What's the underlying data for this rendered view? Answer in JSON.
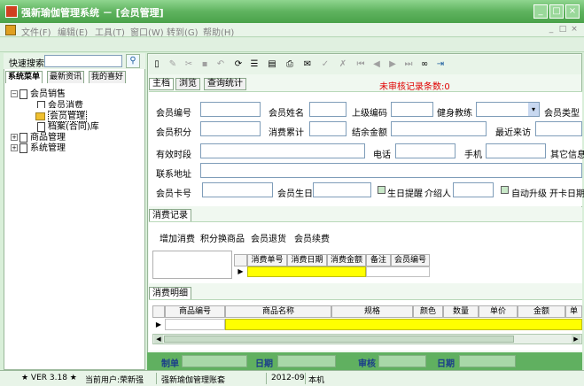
{
  "window": {
    "title": "强新瑜伽管理系统 － [会员管理]",
    "buttons": [
      "_",
      "□",
      "×"
    ]
  },
  "menu": {
    "items": [
      "文件(F)",
      "编辑(E)",
      "工具(T)",
      "窗口(W)",
      "转到(G)",
      "帮助(H)"
    ],
    "mdi_buttons": [
      "_",
      "□",
      "×"
    ]
  },
  "left": {
    "quick_search_label": "快速搜索",
    "tabs": [
      "系统菜单",
      "最新资讯",
      "我的喜好"
    ],
    "tree": [
      {
        "label": "会员销售",
        "expand": "⊟"
      },
      {
        "label": "会员消费"
      },
      {
        "label": "会员管理"
      },
      {
        "label": "档案(合同)库"
      },
      {
        "label": "商品管理",
        "expand": "⊞"
      },
      {
        "label": "系统管理",
        "expand": "⊞"
      }
    ]
  },
  "right": {
    "tabs": [
      "主档",
      "浏览",
      "查询统计"
    ],
    "audit_text": "未审核记录条数:0",
    "form_labels": {
      "member_no": "会员编号",
      "member_name": "会员姓名",
      "upper_code": "上级编码",
      "coach": "健身教练",
      "member_type": "会员类型",
      "points": "会员积分",
      "total_spent": "消费累计",
      "balance": "结余金额",
      "last_visit": "最近来访",
      "valid_period": "有效时段",
      "phone": "电话",
      "mobile": "手机",
      "other": "其它信息",
      "address": "联系地址",
      "card_no": "会员卡号",
      "birthday": "会员生日",
      "birthday_remind": "生日提醒",
      "referrer": "介绍人",
      "auto_upgrade": "自动升级",
      "open_date": "开卡日期"
    },
    "consume": {
      "tab": "消费记录",
      "actions": [
        "增加消费",
        "积分换商品",
        "会员退货",
        "会员续费"
      ],
      "columns": [
        "消费单号",
        "消费日期",
        "消费金额",
        "备注",
        "会员编号"
      ]
    },
    "detail": {
      "tab": "消费明细",
      "columns": [
        "商品编号",
        "商品名称",
        "规格",
        "颜色",
        "数量",
        "单价",
        "金额",
        "单"
      ]
    },
    "footer": {
      "maker": "制单",
      "date1": "日期",
      "audit": "审核",
      "date2": "日期"
    }
  },
  "status": {
    "version": "★ VER 3.18 ★",
    "user": "当前用户:荣新强",
    "account": "强新瑜伽管理账套",
    "period": "2012-09",
    "location": "本机"
  }
}
